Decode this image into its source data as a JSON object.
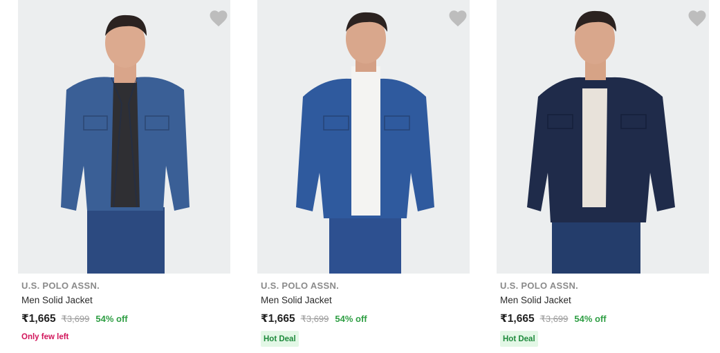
{
  "products": [
    {
      "brand": "U.S. POLO ASSN.",
      "title": "Men Solid Jacket",
      "price": "₹1,665",
      "mrp": "₹3,699",
      "discount": "54% off",
      "tag": "Only few left",
      "tag_type": "stock",
      "jacket_color": "#3a5f96",
      "inner_color": "#2f2f33"
    },
    {
      "brand": "U.S. POLO ASSN.",
      "title": "Men Solid Jacket",
      "price": "₹1,665",
      "mrp": "₹3,699",
      "discount": "54% off",
      "tag": "Hot Deal",
      "tag_type": "deal",
      "jacket_color": "#2f5a9e",
      "inner_color": "#f4f4f2"
    },
    {
      "brand": "U.S. POLO ASSN.",
      "title": "Men Solid Jacket",
      "price": "₹1,665",
      "mrp": "₹3,699",
      "discount": "54% off",
      "tag": "Hot Deal",
      "tag_type": "deal",
      "jacket_color": "#1f2b4a",
      "inner_color": "#e8e2da"
    }
  ],
  "colors": {
    "discount": "#2f9e44",
    "stock_tag": "#d1145a",
    "deal_tag_text": "#1e8a3c",
    "deal_tag_bg": "#e3f7e6",
    "wishlist_icon": "#bdbdbd"
  },
  "icons": {
    "wishlist": "heart-icon"
  }
}
